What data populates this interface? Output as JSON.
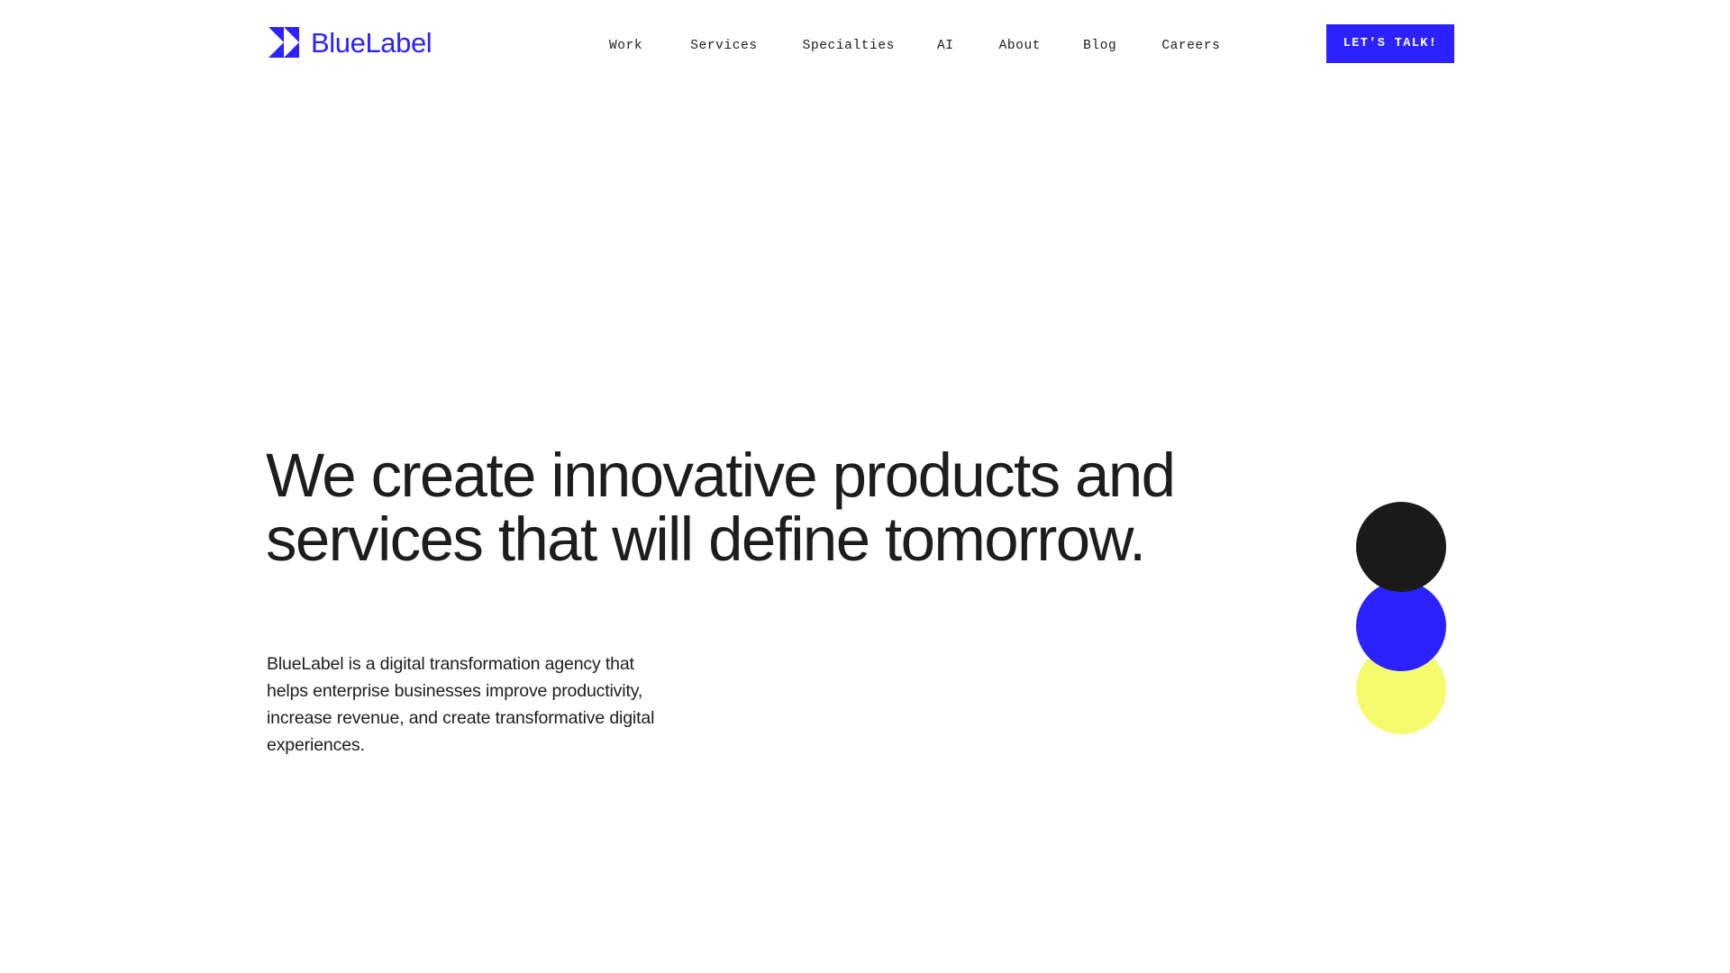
{
  "brand": {
    "name": "BlueLabel",
    "mark_icon": "double-chevron-right-icon",
    "color": "#2b22ff"
  },
  "nav": {
    "items": [
      {
        "label": "Work"
      },
      {
        "label": "Services"
      },
      {
        "label": "Specialties"
      },
      {
        "label": "AI"
      },
      {
        "label": "About"
      },
      {
        "label": "Blog"
      },
      {
        "label": "Careers"
      }
    ]
  },
  "header": {
    "cta_label": "LET'S TALK!",
    "cta_background": "#2b22ff",
    "cta_text_color": "#ffffff"
  },
  "hero": {
    "headline_line_1": "We create innovative products and",
    "headline_line_2": "services that will define tomorrow.",
    "body": "BlueLabel is a digital transformation agency that helps enterprise businesses improve productivity, increase revenue, and create transformative digital experiences."
  },
  "decoration": {
    "circles": [
      {
        "name": "black",
        "color": "#1a1a1a"
      },
      {
        "name": "blue",
        "color": "#2b22ff"
      },
      {
        "name": "yellow",
        "color": "#f4fc6e"
      }
    ]
  },
  "theme": {
    "background": "#ffffff",
    "text_color": "#1d1d1d",
    "accent": "#2b22ff"
  }
}
